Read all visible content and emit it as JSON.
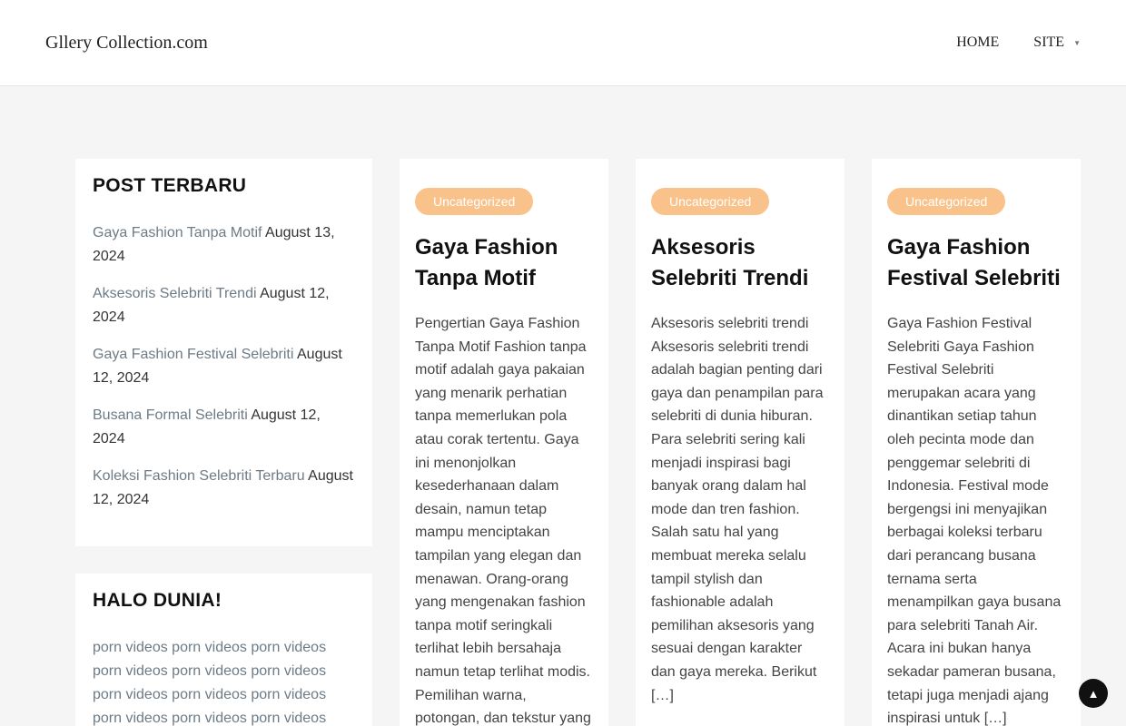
{
  "header": {
    "site_title": "Gllery Collection.com",
    "nav": [
      {
        "label": "HOME"
      },
      {
        "label": "SITE",
        "icon": "chevron-down-icon"
      }
    ]
  },
  "sidebar": {
    "recent": {
      "title": "POST TERBARU",
      "items": [
        {
          "title": "Gaya Fashion Tanpa Motif",
          "date": "August 13, 2024"
        },
        {
          "title": "Aksesoris Selebriti Trendi",
          "date": "August 12, 2024"
        },
        {
          "title": "Gaya Fashion Festival Selebriti",
          "date": "August 12, 2024"
        },
        {
          "title": "Busana Formal Selebriti",
          "date": "August 12, 2024"
        },
        {
          "title": "Koleksi Fashion Selebriti Terbaru",
          "date": "August 12, 2024"
        }
      ]
    },
    "halo": {
      "title": "HALO DUNIA!",
      "links": [
        "porn videos",
        "porn videos",
        "porn videos",
        "porn videos",
        "porn videos",
        "porn videos",
        "porn videos",
        "porn videos",
        "porn videos",
        "porn videos",
        "porn videos",
        "porn videos"
      ]
    }
  },
  "posts": [
    {
      "category": "Uncategorized",
      "title": "Gaya Fashion Tanpa Motif",
      "excerpt": "Pengertian Gaya Fashion Tanpa Motif Fashion tanpa motif adalah gaya pakaian yang menarik perhatian tanpa memerlukan pola atau corak tertentu. Gaya ini menonjolkan kesederhanaan dalam desain, namun tetap mampu menciptakan tampilan yang elegan dan menawan. Orang-orang yang mengenakan fashion tanpa motif seringkali terlihat lebih bersahaja namun tetap terlihat modis. Pemilihan warna, potongan, dan tekstur yang"
    },
    {
      "category": "Uncategorized",
      "title": "Aksesoris Selebriti Trendi",
      "excerpt": "Aksesoris selebriti trendi Aksesoris selebriti trendi adalah bagian penting dari gaya dan penampilan para selebriti di dunia hiburan. Para selebriti sering kali menjadi inspirasi bagi banyak orang dalam hal mode dan tren fashion. Salah satu hal yang membuat mereka selalu tampil stylish dan fashionable adalah pemilihan aksesoris yang sesuai dengan karakter dan gaya mereka. Berikut […]"
    },
    {
      "category": "Uncategorized",
      "title": "Gaya Fashion Festival Selebriti",
      "excerpt": "Gaya Fashion Festival Selebriti Gaya Fashion Festival Selebriti merupakan acara yang dinantikan setiap tahun oleh pecinta mode dan penggemar selebriti di Indonesia. Festival mode bergengsi ini menyajikan berbagai koleksi terbaru dari perancang busana ternama serta menampilkan gaya busana para selebriti Tanah Air. Acara ini bukan hanya sekadar pameran busana, tetapi juga menjadi ajang inspirasi untuk […]"
    }
  ],
  "scroll_top_icon": "chevron-up-icon"
}
